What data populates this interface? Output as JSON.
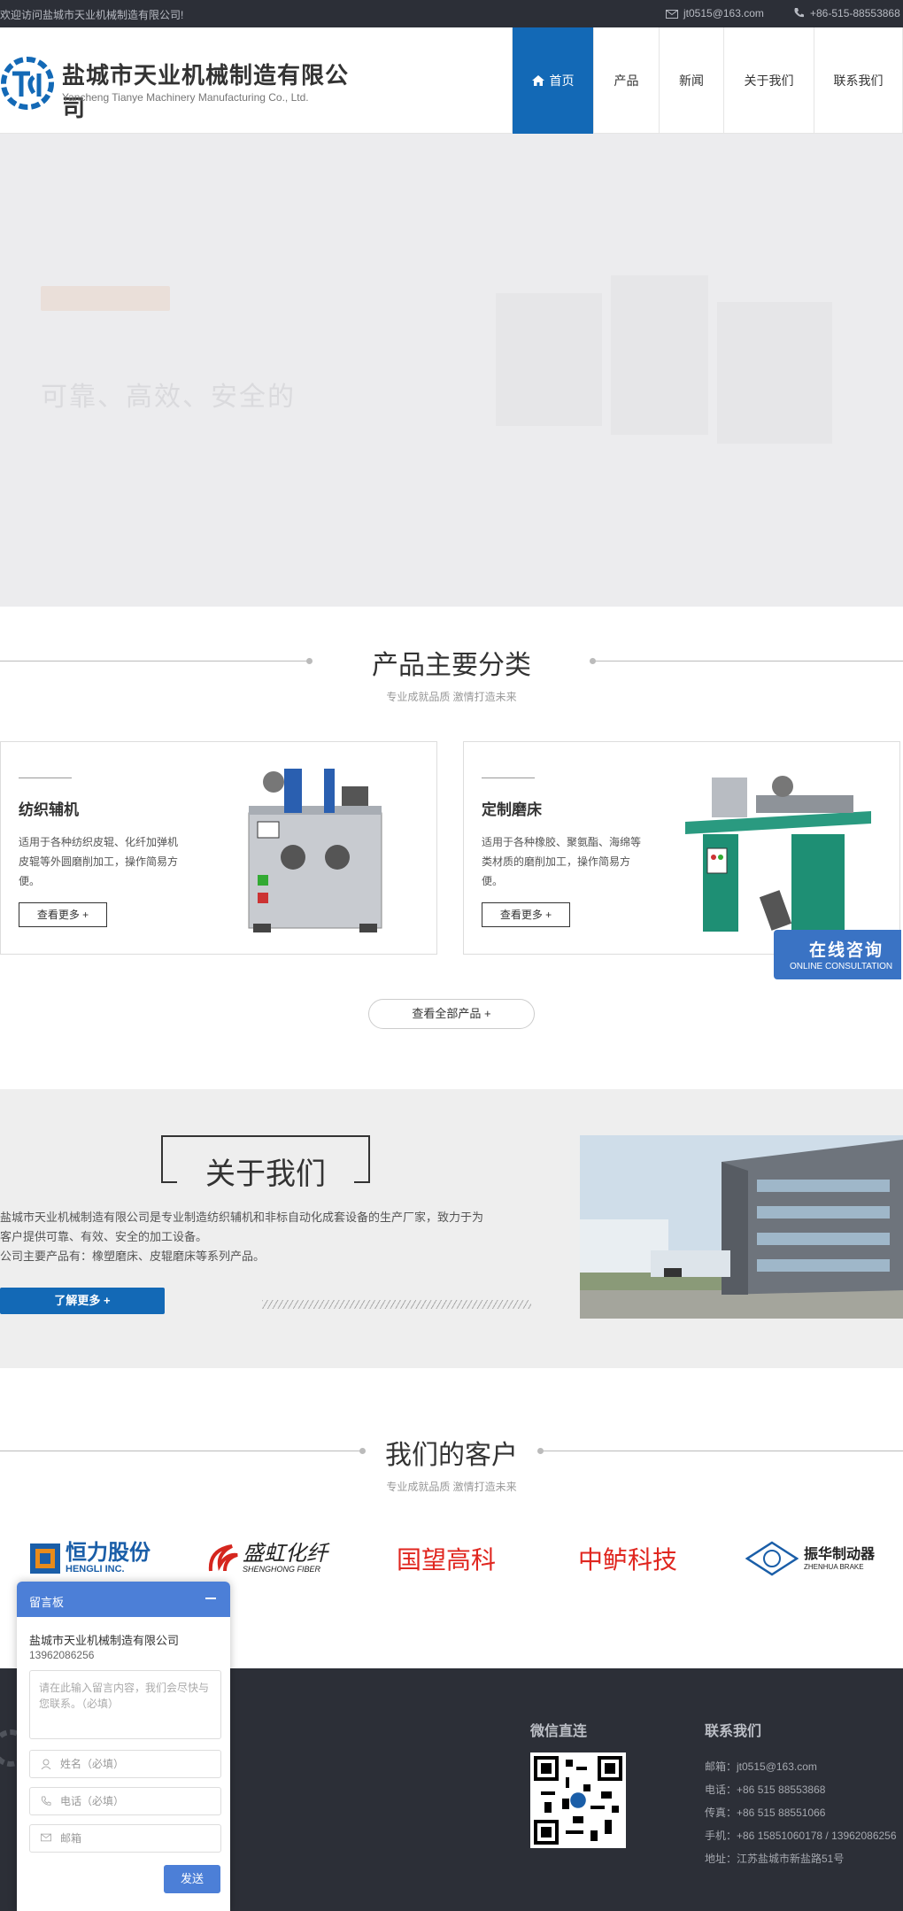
{
  "topbar": {
    "welcome": "欢迎访问盐城市天业机械制造有限公司!",
    "email": "jt0515@163.com",
    "phone": "+86-515-88553868"
  },
  "header": {
    "company_cn": "盐城市天业机械制造有限公司",
    "company_en": "Yancheng Tianye Machinery Manufacturing Co., Ltd."
  },
  "nav": [
    {
      "label": "首页",
      "active": true
    },
    {
      "label": "产品",
      "active": false
    },
    {
      "label": "新闻",
      "active": false
    },
    {
      "label": "关于我们",
      "active": false
    },
    {
      "label": "联系我们",
      "active": false
    }
  ],
  "hero": {
    "slogan": "可靠、高效、安全的"
  },
  "products": {
    "title": "产品主要分类",
    "subtitle": "专业成就品质 激情打造未来",
    "cards": [
      {
        "title": "纺织辅机",
        "desc": "适用于各种纺织皮辊、化纤加弹机皮辊等外圆磨削加工，操作简易方便。",
        "more": "查看更多 +"
      },
      {
        "title": "定制磨床",
        "desc": "适用于各种橡胶、聚氨酯、海绵等类材质的磨削加工，操作简易方便。",
        "more": "查看更多 +"
      }
    ],
    "all_button": "查看全部产品 +"
  },
  "consult": {
    "cn": "在线咨询",
    "en": "ONLINE CONSULTATION"
  },
  "about": {
    "title": "关于我们",
    "line1": "盐城市天业机械制造有限公司是专业制造纺织辅机和非标自动化成套设备的生产厂家，致力于为",
    "line2": "客户提供可靠、有效、安全的加工设备。",
    "line3": "公司主要产品有：橡塑磨床、皮辊磨床等系列产品。",
    "button": "了解更多 +"
  },
  "clients": {
    "title": "我们的客户",
    "subtitle": "专业成就品质 激情打造未来",
    "logos": [
      {
        "cn": "恒力股份",
        "en": "HENGLI INC."
      },
      {
        "cn": "盛虹化纤",
        "en": "SHENGHONG FIBER"
      },
      {
        "cn": "国望高科",
        "en": ""
      },
      {
        "cn": "中鲈科技",
        "en": ""
      },
      {
        "cn": "振华制动器",
        "en": "ZHENHUA BRAKE"
      }
    ]
  },
  "footer": {
    "wechat_title": "微信直连",
    "contact_title": "联系我们",
    "email": "邮箱：jt0515@163.com",
    "tel": "电话：+86 515 88553868",
    "fax": "传真：+86 515 88551066",
    "mobile": "手机：+86 15851060178 / 13962086256",
    "address": "地址：江苏盐城市新盐路51号"
  },
  "message_board": {
    "title": "留言板",
    "company": "盐城市天业机械制造有限公司",
    "phone": "13962086256",
    "textarea_placeholder": "请在此输入留言内容，我们会尽快与您联系。（必填）",
    "name_placeholder": "姓名（必填）",
    "tel_placeholder": "电话（必填）",
    "email_placeholder": "邮箱",
    "send": "发送"
  },
  "colors": {
    "brand_blue": "#1369b6",
    "dark": "#2c2f37",
    "client_red": "#e0261f"
  }
}
